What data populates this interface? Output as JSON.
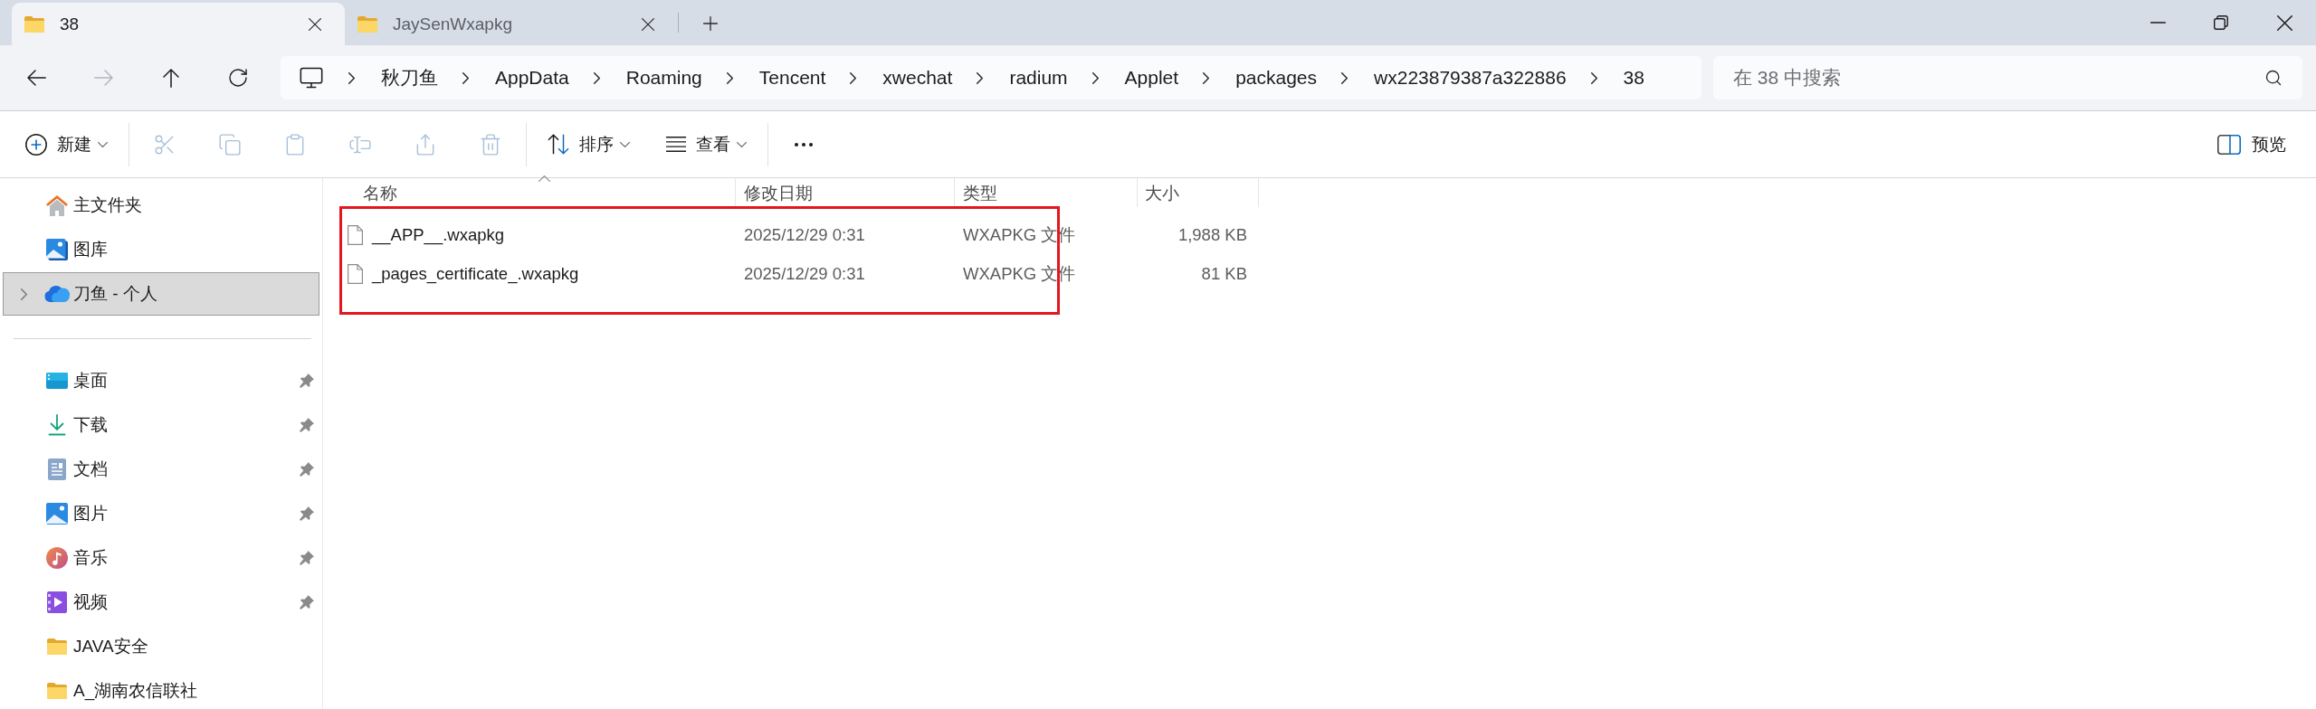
{
  "tabs": [
    {
      "title": "38",
      "selected": true
    },
    {
      "title": "JaySenWxapkg",
      "selected": false
    }
  ],
  "navigation": [
    {
      "kind": "back",
      "disabled": false
    },
    {
      "kind": "forward",
      "disabled": true
    },
    {
      "kind": "up",
      "disabled": false
    },
    {
      "kind": "refresh",
      "disabled": false
    }
  ],
  "breadcrumbs": [
    "秋刀鱼",
    "AppData",
    "Roaming",
    "Tencent",
    "xwechat",
    "radium",
    "Applet",
    "packages",
    "wx223879387a322886",
    "38"
  ],
  "search": {
    "placeholder": "在 38 中搜索"
  },
  "toolbar": {
    "groups": [
      [
        {
          "kind": "new",
          "label": "新建",
          "disabled": false
        }
      ],
      [
        {
          "kind": "cut",
          "disabled": true
        },
        {
          "kind": "copy",
          "disabled": true
        },
        {
          "kind": "paste",
          "disabled": true
        },
        {
          "kind": "rename",
          "disabled": true
        },
        {
          "kind": "share",
          "disabled": true
        },
        {
          "kind": "delete",
          "disabled": true
        }
      ],
      [
        {
          "kind": "sort",
          "label": "排序",
          "disabled": false
        },
        {
          "kind": "view",
          "label": "查看",
          "disabled": false
        }
      ],
      [
        {
          "kind": "more",
          "disabled": false
        }
      ]
    ],
    "preview": {
      "label": "预览"
    }
  },
  "sidebar": {
    "top_items": [
      {
        "kind": "home",
        "label": "主文件夹",
        "selected": false
      },
      {
        "kind": "gallery",
        "label": "图库",
        "selected": false
      },
      {
        "kind": "cloud",
        "label": "刀鱼 - 个人",
        "selected": true,
        "expanded": false
      }
    ],
    "quick_access": [
      {
        "kind": "desktop",
        "label": "桌面",
        "pinned": true,
        "selected": false
      },
      {
        "kind": "downloads",
        "label": "下载",
        "pinned": true,
        "selected": false
      },
      {
        "kind": "documents",
        "label": "文档",
        "pinned": true,
        "selected": false
      },
      {
        "kind": "pictures",
        "label": "图片",
        "pinned": true,
        "selected": false
      },
      {
        "kind": "music",
        "label": "音乐",
        "pinned": true,
        "selected": false
      },
      {
        "kind": "videos",
        "label": "视频",
        "pinned": true,
        "selected": false
      },
      {
        "kind": "folder",
        "label": "JAVA安全",
        "pinned": false,
        "selected": false
      },
      {
        "kind": "folder",
        "label": "A_湖南农信联社",
        "pinned": false,
        "selected": false
      }
    ]
  },
  "file_list": {
    "columns": [
      {
        "label": "名称",
        "sorted": true
      },
      {
        "label": "修改日期",
        "sorted": false
      },
      {
        "label": "类型",
        "sorted": false
      },
      {
        "label": "大小",
        "sorted": false
      }
    ],
    "rows": [
      {
        "name": "__APP__.wxapkg",
        "modified": "2025/12/29 0:31",
        "type": "WXAPKG 文件",
        "size": "1,988 KB"
      },
      {
        "name": "_pages_certificate_.wxapkg",
        "modified": "2025/12/29 0:31",
        "type": "WXAPKG 文件",
        "size": "81 KB"
      }
    ]
  }
}
